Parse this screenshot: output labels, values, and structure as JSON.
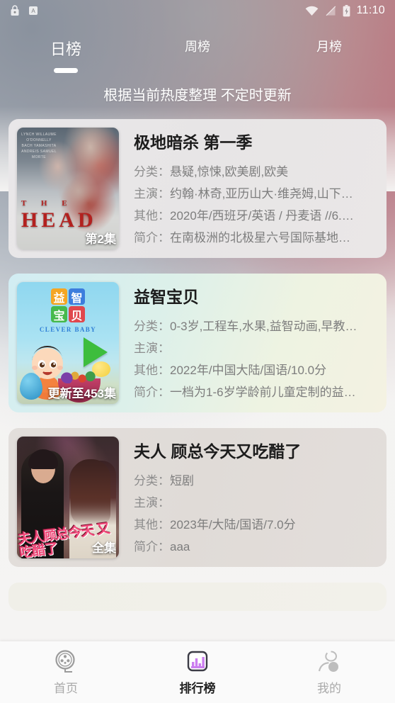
{
  "status_bar": {
    "time": "11:10",
    "left_icons": [
      "lock-icon",
      "app-icon"
    ],
    "right_icons": [
      "wifi-icon",
      "signal-off-icon",
      "battery-charging-icon"
    ]
  },
  "tabs": [
    {
      "label": "日榜",
      "active": true
    },
    {
      "label": "周榜",
      "active": false
    },
    {
      "label": "月榜",
      "active": false
    }
  ],
  "subtitle": "根据当前热度整理 不定时更新",
  "labels": {
    "category": "分类：",
    "cast": "主演：",
    "other": "其他：",
    "summary": "简介："
  },
  "cards": [
    {
      "title": "极地暗杀 第一季",
      "category": "悬疑,惊悚,欧美剧,欧美",
      "cast": "约翰·林奇,亚历山大·维尧姆,山下…",
      "other": "2020年/西班牙/英语 / 丹麦语 //6.…",
      "summary": "在南极洲的北极星六号国际基地…",
      "episode_badge": "第2集",
      "poster": {
        "main_title": "HEAD",
        "pre_title": "T H E",
        "cast_list": "LYNCH\nWILLAUME\nO'DONNELLY\nBACH\nYAMASHITA\nANDREIS\nSAMUEL\nMORTE"
      },
      "card_bg": "#e8e6e8"
    },
    {
      "title": "益智宝贝",
      "category": "0-3岁,工程车,水果,益智动画,早教…",
      "cast": "",
      "other": "2022年/中国大陆/国语/10.0分",
      "summary": "一档为1-6岁学龄前儿童定制的益…",
      "episode_badge": "更新至453集",
      "poster": {
        "logo_chars": [
          "益",
          "智",
          "宝",
          "贝"
        ],
        "sub_title": "CLEVER BABY"
      },
      "card_bg": "#d9eef2"
    },
    {
      "title": "夫人 顾总今天又吃醋了",
      "category": "短剧",
      "cast": "",
      "other": "2023年/大陆/国语/7.0分",
      "summary": "aaa",
      "episode_badge": "全集",
      "poster": {
        "overlay_title": "夫人顾总今天\n又吃醋了"
      },
      "card_bg": "#e1dcd8"
    }
  ],
  "bottom_nav": [
    {
      "label": "首页",
      "icon": "film-reel-icon",
      "active": false
    },
    {
      "label": "排行榜",
      "icon": "bar-chart-icon",
      "active": true
    },
    {
      "label": "我的",
      "icon": "person-icon",
      "active": false
    }
  ],
  "colors": {
    "accent": "#cc7ef0",
    "nav_active_text": "#1f1f1f",
    "nav_inactive_text": "#a9a9a9",
    "card_title": "#1c1c1c",
    "meta_text": "#8d8d8d"
  }
}
